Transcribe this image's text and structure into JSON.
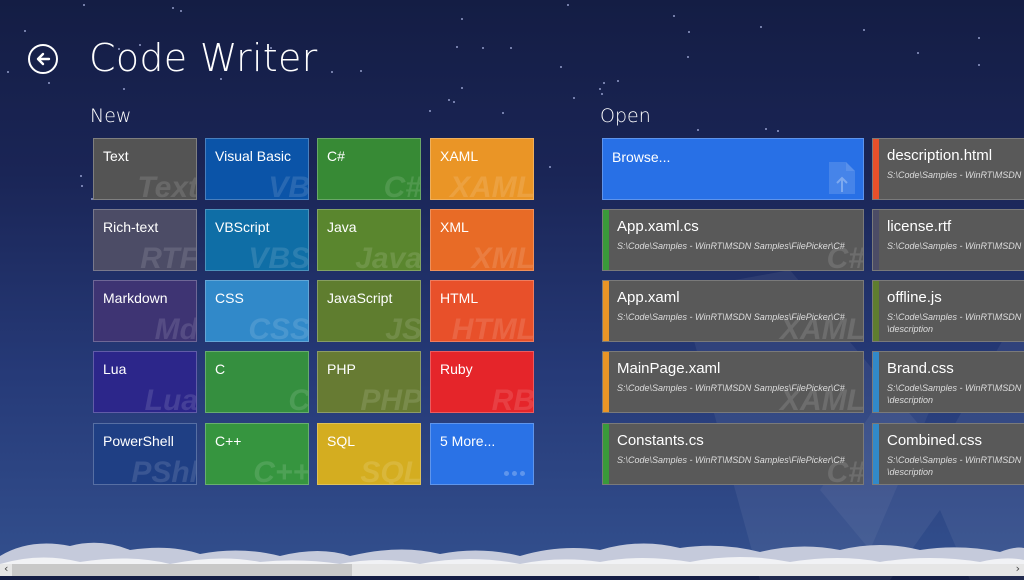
{
  "header": {
    "title": "Code Writer",
    "back_icon": "back-arrow-icon"
  },
  "new_section": {
    "title": "New",
    "tiles": [
      {
        "label": "Text",
        "ghost": "Text",
        "color": "#545454"
      },
      {
        "label": "Visual Basic",
        "ghost": "VB",
        "color": "#0b54a8"
      },
      {
        "label": "C#",
        "ghost": "C#",
        "color": "#378a35"
      },
      {
        "label": "XAML",
        "ghost": "XAML",
        "color": "#ea9526"
      },
      {
        "label": "Rich-text",
        "ghost": "RTF",
        "color": "#4c4c66"
      },
      {
        "label": "VBScript",
        "ghost": "VBS",
        "color": "#0f6ea6"
      },
      {
        "label": "Java",
        "ghost": "Java",
        "color": "#5a862e"
      },
      {
        "label": "XML",
        "ghost": "XML",
        "color": "#e86b26"
      },
      {
        "label": "Markdown",
        "ghost": "Md",
        "color": "#3e3473"
      },
      {
        "label": "CSS",
        "ghost": "CSS",
        "color": "#3189c9"
      },
      {
        "label": "JavaScript",
        "ghost": "JS",
        "color": "#5f7d2f"
      },
      {
        "label": "HTML",
        "ghost": "HTML",
        "color": "#e8502a"
      },
      {
        "label": "Lua",
        "ghost": "Lua",
        "color": "#2c268a"
      },
      {
        "label": "C",
        "ghost": "C",
        "color": "#358f3f"
      },
      {
        "label": "PHP",
        "ghost": "PHP",
        "color": "#677b33"
      },
      {
        "label": "Ruby",
        "ghost": "RB",
        "color": "#e5252a"
      },
      {
        "label": "PowerShell",
        "ghost": "PShl",
        "color": "#1f3f84"
      },
      {
        "label": "C++",
        "ghost": "C++",
        "color": "#36953f"
      },
      {
        "label": "SQL",
        "ghost": "SQL",
        "color": "#d4ad20"
      },
      {
        "label": "5 More...",
        "ghost": "",
        "color": "#2a72e6",
        "dots": true
      }
    ]
  },
  "open_section": {
    "title": "Open",
    "browse_label": "Browse...",
    "files": [
      {
        "name": "App.xaml.cs",
        "path": "S:\\Code\\Samples - WinRT\\MSDN Samples\\FilePicker\\C#",
        "ghost": "C#",
        "accent": "#3a9a3a"
      },
      {
        "name": "App.xaml",
        "path": "S:\\Code\\Samples - WinRT\\MSDN Samples\\FilePicker\\C#",
        "ghost": "XAML",
        "accent": "#ea9526"
      },
      {
        "name": "MainPage.xaml",
        "path": "S:\\Code\\Samples - WinRT\\MSDN Samples\\FilePicker\\C#",
        "ghost": "XAML",
        "accent": "#ea9526"
      },
      {
        "name": "Constants.cs",
        "path": "S:\\Code\\Samples - WinRT\\MSDN Samples\\FilePicker\\C#",
        "ghost": "C#",
        "accent": "#3a9a3a"
      },
      {
        "name": "description.html",
        "path": "S:\\Code\\Samples - WinRT\\MSDN Samples",
        "path2": "",
        "ghost": "",
        "accent": "#e8502a"
      },
      {
        "name": "license.rtf",
        "path": "S:\\Code\\Samples - WinRT\\MSDN Samples",
        "path2": "",
        "ghost": "",
        "accent": "#4c4c66"
      },
      {
        "name": "offline.js",
        "path": "S:\\Code\\Samples - WinRT\\MSDN Samples",
        "path2": "\\description",
        "ghost": "",
        "accent": "#5f7d2f"
      },
      {
        "name": "Brand.css",
        "path": "S:\\Code\\Samples - WinRT\\MSDN Samples",
        "path2": "\\description",
        "ghost": "",
        "accent": "#3189c9"
      },
      {
        "name": "Combined.css",
        "path": "S:\\Code\\Samples - WinRT\\MSDN Samples",
        "path2": "\\description",
        "ghost": "",
        "accent": "#3189c9"
      }
    ]
  },
  "scrollbar": {
    "position_fraction": 0.0,
    "visible_fraction": 0.34,
    "left_arrow": "‹",
    "right_arrow": "›"
  }
}
